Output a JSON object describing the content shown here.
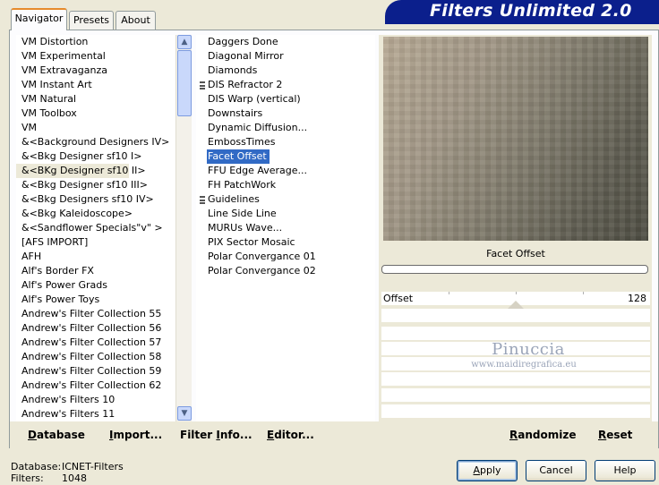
{
  "header": {
    "title": "Filters Unlimited 2.0"
  },
  "tabs": [
    {
      "label": "Navigator",
      "active": true
    },
    {
      "label": "Presets",
      "active": false
    },
    {
      "label": "About",
      "active": false
    }
  ],
  "categories": [
    "VM Distortion",
    "VM Experimental",
    "VM Extravaganza",
    "VM Instant Art",
    "VM Natural",
    "VM Toolbox",
    "VM",
    "&<Background Designers IV>",
    "&<Bkg Designer sf10 I>",
    "&<BKg Designer sf10 II>",
    "&<Bkg Designer sf10 III>",
    "&<Bkg Designers sf10 IV>",
    "&<Bkg Kaleidoscope>",
    "&<Sandflower Specials\"v\" >",
    "[AFS IMPORT]",
    "AFH",
    "Alf's Border FX",
    "Alf's Power Grads",
    "Alf's Power Toys",
    "Andrew's Filter Collection 55",
    "Andrew's Filter Collection 56",
    "Andrew's Filter Collection 57",
    "Andrew's Filter Collection 58",
    "Andrew's Filter Collection 59",
    "Andrew's Filter Collection 62",
    "Andrew's Filters 10",
    "Andrew's Filters 11"
  ],
  "categories_highlighted_index": 9,
  "filters": [
    {
      "label": "Daggers Done",
      "group": false
    },
    {
      "label": "Diagonal Mirror",
      "group": false
    },
    {
      "label": "Diamonds",
      "group": false
    },
    {
      "label": "DIS Refractor 2",
      "group": true
    },
    {
      "label": "DIS Warp (vertical)",
      "group": false
    },
    {
      "label": "Downstairs",
      "group": false
    },
    {
      "label": "Dynamic Diffusion...",
      "group": false
    },
    {
      "label": "EmbossTimes",
      "group": false
    },
    {
      "label": "Facet Offset",
      "group": false,
      "selected": true
    },
    {
      "label": "FFU Edge Average...",
      "group": false
    },
    {
      "label": "FH PatchWork",
      "group": false
    },
    {
      "label": "Guidelines",
      "group": true
    },
    {
      "label": "Line Side Line",
      "group": false
    },
    {
      "label": "MURUs Wave...",
      "group": false
    },
    {
      "label": "PIX Sector Mosaic",
      "group": false
    },
    {
      "label": "Polar Convergance 01",
      "group": false
    },
    {
      "label": "Polar Convergance 02",
      "group": false
    }
  ],
  "scrollbar": {
    "up_icon": "arrow-up-icon",
    "down_icon": "arrow-down-icon"
  },
  "preview": {
    "filter_name": "Facet Offset"
  },
  "params": [
    {
      "label": "Offset",
      "value": "128",
      "fraction": 0.5
    }
  ],
  "watermark": {
    "main": "Pinuccia",
    "sub": "www.maidiregrafica.eu"
  },
  "actions": {
    "database": {
      "label_u": "D",
      "label_rest": "atabase"
    },
    "import": {
      "label_u": "I",
      "label_rest": "mport..."
    },
    "filter_info": {
      "label_pre": "Filter ",
      "label_u": "I",
      "label_rest": "nfo..."
    },
    "editor": {
      "label_u": "E",
      "label_rest": "ditor..."
    },
    "randomize": {
      "label_u": "R",
      "label_rest": "andomize"
    },
    "reset": {
      "label_u": "R",
      "label_rest": "eset"
    }
  },
  "status": {
    "database_label": "Database:",
    "database_value": "ICNET-Filters",
    "filters_label": "Filters:",
    "filters_value": "1048"
  },
  "buttons": {
    "apply": {
      "label_u": "A",
      "label_rest": "pply"
    },
    "cancel": "Cancel",
    "help": "Help"
  }
}
